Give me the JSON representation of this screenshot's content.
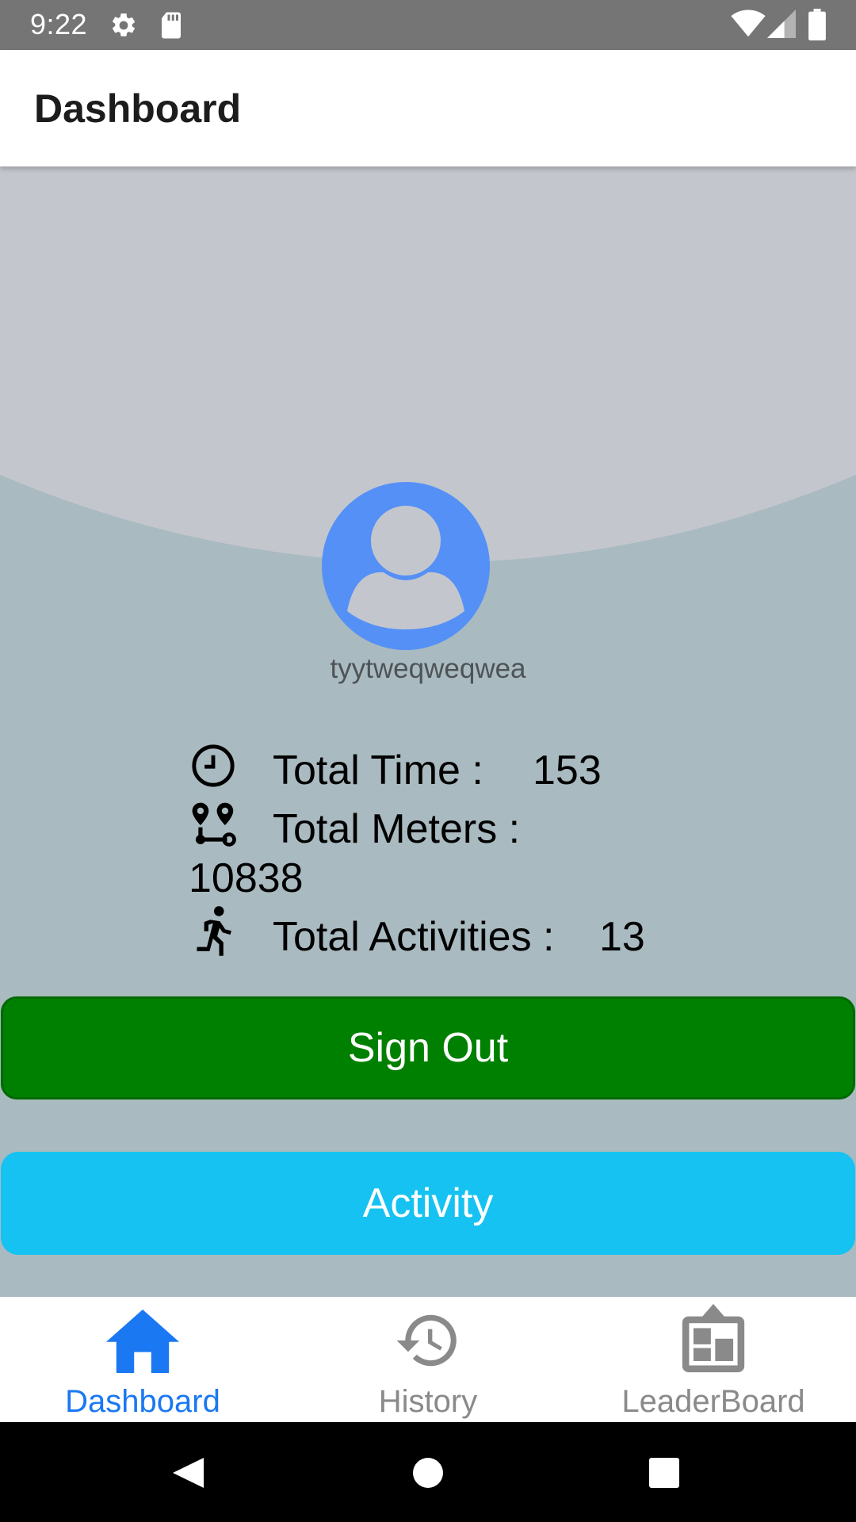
{
  "status_bar": {
    "time": "9:22",
    "icons": [
      "settings-icon",
      "sd-card-icon",
      "wifi-icon",
      "signal-icon",
      "battery-icon"
    ]
  },
  "app_bar": {
    "title": "Dashboard"
  },
  "profile": {
    "username": "tyytweqweqwea",
    "avatar_icon": "account-circle-icon"
  },
  "stats": [
    {
      "icon": "clock-icon",
      "label": "Total Time :",
      "value": "153"
    },
    {
      "icon": "route-icon",
      "label": "Total Meters :",
      "value": "10838"
    },
    {
      "icon": "run-icon",
      "label": "Total Activities :",
      "value": "13"
    }
  ],
  "buttons": {
    "sign_out": "Sign Out",
    "activity": "Activity"
  },
  "bottom_nav": {
    "items": [
      {
        "label": "Dashboard",
        "icon": "home-icon",
        "active": true
      },
      {
        "label": "History",
        "icon": "history-icon",
        "active": false
      },
      {
        "label": "LeaderBoard",
        "icon": "leaderboard-icon",
        "active": false
      }
    ]
  },
  "system_nav": {
    "icons": [
      "back-icon",
      "home-circle-icon",
      "recents-icon"
    ]
  },
  "colors": {
    "status_bar": "#757575",
    "arc": "#c3c7cd",
    "content_background": "#a9bac0",
    "avatar": "#5590f6",
    "sign_out": "#008000",
    "activity": "#16c2f1",
    "active_nav": "#1a78f2",
    "inactive_nav": "#8a8a8a"
  }
}
